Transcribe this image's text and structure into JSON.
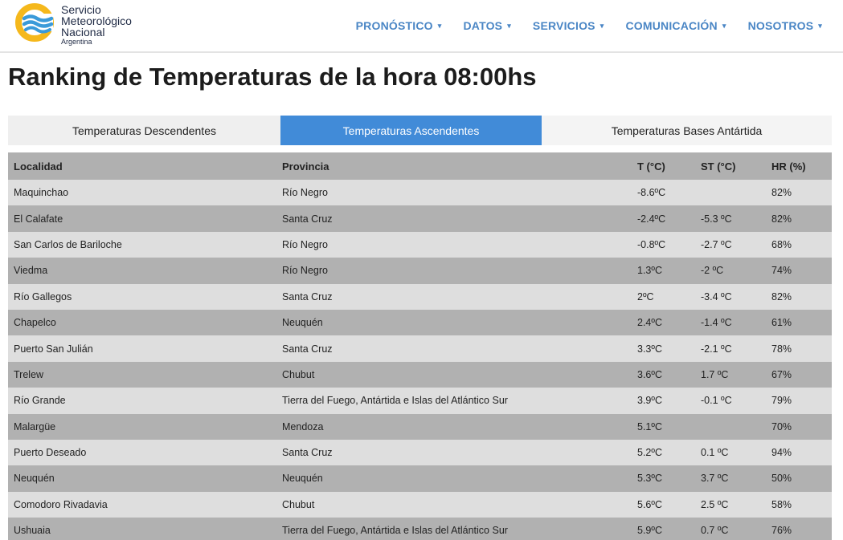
{
  "header": {
    "logo": {
      "line1": "Servicio",
      "line2": "Meteorológico",
      "line3": "Nacional",
      "sub": "Argentina",
      "colors": {
        "ring": "#f5b81c",
        "waves": "#3a9ad9"
      }
    },
    "nav": [
      {
        "label": "PRONÓSTICO",
        "caret": "▾"
      },
      {
        "label": "DATOS",
        "caret": "▾"
      },
      {
        "label": "SERVICIOS",
        "caret": "▾"
      },
      {
        "label": "COMUNICACIÓN",
        "caret": "▾"
      },
      {
        "label": "NOSOTROS",
        "caret": "▾"
      }
    ]
  },
  "page_title": "Ranking de Temperaturas de la hora 08:00hs",
  "tabs": [
    {
      "label": "Temperaturas Descendentes",
      "active": false
    },
    {
      "label": "Temperaturas Ascendentes",
      "active": true
    },
    {
      "label": "Temperaturas Bases Antártida",
      "active": false
    }
  ],
  "table": {
    "columns": [
      "Localidad",
      "Provincia",
      "T (°C)",
      "ST (°C)",
      "HR (%)"
    ],
    "rows": [
      [
        "Maquinchao",
        "Río Negro",
        "-8.6ºC",
        "",
        "82%"
      ],
      [
        "El Calafate",
        "Santa Cruz",
        "-2.4ºC",
        "-5.3 ºC",
        "82%"
      ],
      [
        "San Carlos de Bariloche",
        "Río Negro",
        "-0.8ºC",
        "-2.7 ºC",
        "68%"
      ],
      [
        "Viedma",
        "Río Negro",
        "1.3ºC",
        "-2 ºC",
        "74%"
      ],
      [
        "Río Gallegos",
        "Santa Cruz",
        "2ºC",
        "-3.4 ºC",
        "82%"
      ],
      [
        "Chapelco",
        "Neuquén",
        "2.4ºC",
        "-1.4 ºC",
        "61%"
      ],
      [
        "Puerto San Julián",
        "Santa Cruz",
        "3.3ºC",
        "-2.1 ºC",
        "78%"
      ],
      [
        "Trelew",
        "Chubut",
        "3.6ºC",
        "1.7 ºC",
        "67%"
      ],
      [
        "Río Grande",
        "Tierra del Fuego, Antártida e Islas del Atlántico Sur",
        "3.9ºC",
        "-0.1 ºC",
        "79%"
      ],
      [
        "Malargüe",
        "Mendoza",
        "5.1ºC",
        "",
        "70%"
      ],
      [
        "Puerto Deseado",
        "Santa Cruz",
        "5.2ºC",
        "0.1 ºC",
        "94%"
      ],
      [
        "Neuquén",
        "Neuquén",
        "5.3ºC",
        "3.7 ºC",
        "50%"
      ],
      [
        "Comodoro Rivadavia",
        "Chubut",
        "5.6ºC",
        "2.5 ºC",
        "58%"
      ],
      [
        "Ushuaia",
        "Tierra del Fuego, Antártida e Islas del Atlántico Sur",
        "5.9ºC",
        "0.7 ºC",
        "76%"
      ]
    ]
  },
  "colors": {
    "nav_text": "#4a86c5",
    "tab_active": "#418bd8",
    "tab_inactive": "#efefef",
    "header_row": "#b0b0b0",
    "row_light": "#dedede",
    "row_dark": "#b1b1b1"
  }
}
